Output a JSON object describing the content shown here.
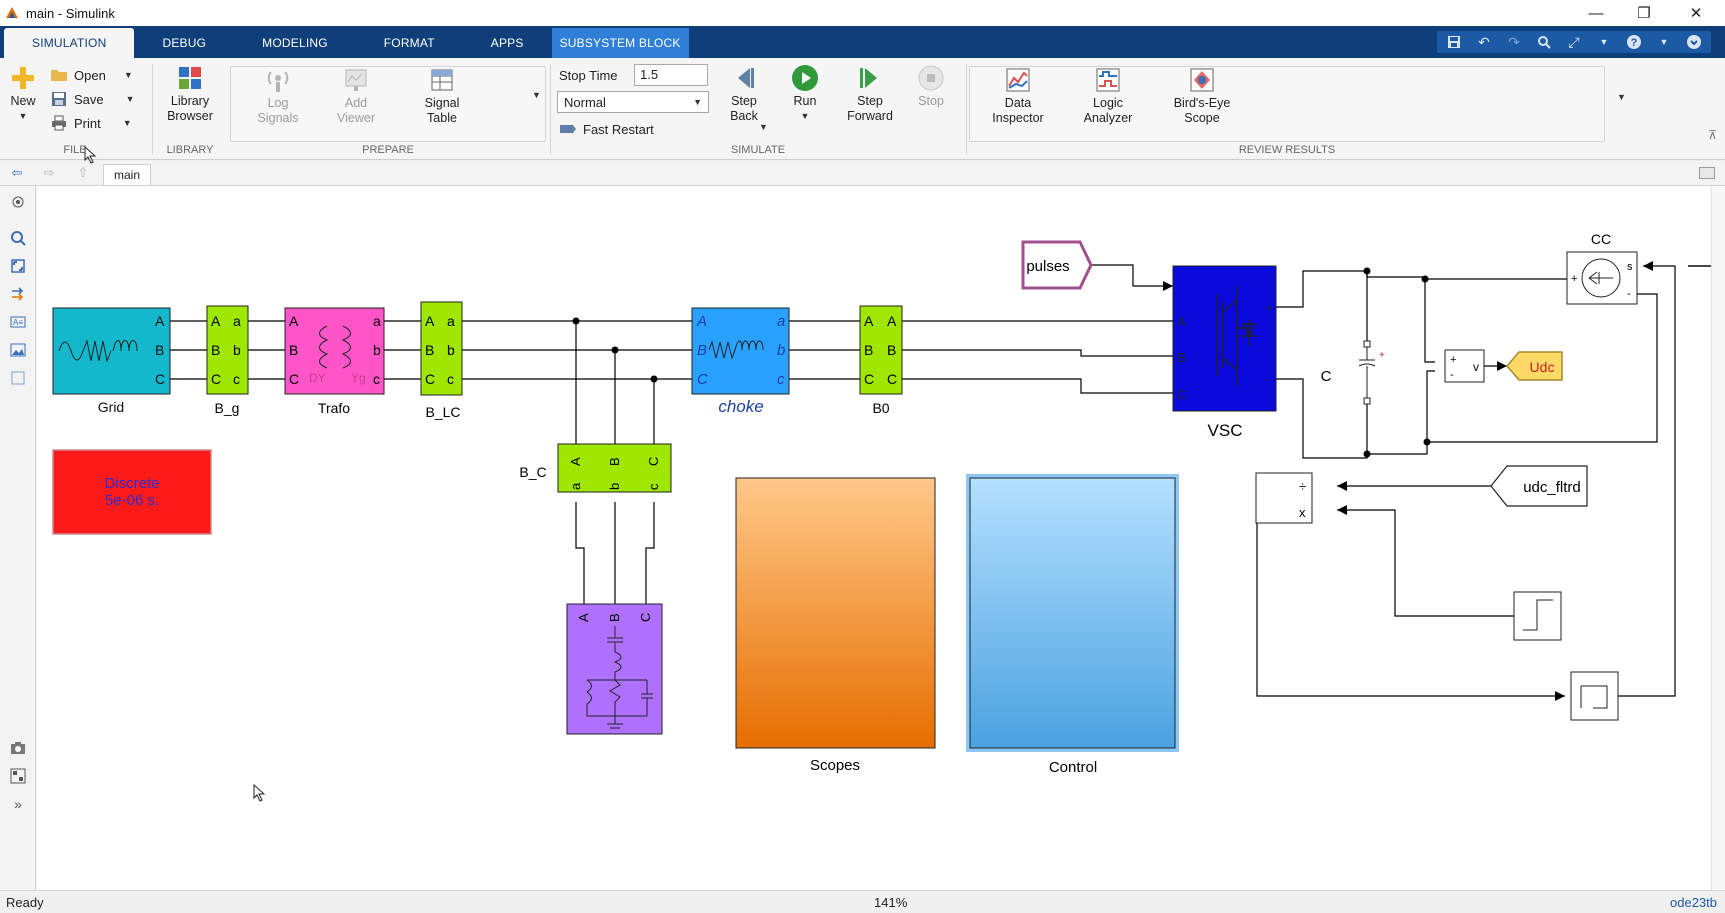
{
  "window": {
    "title": "main - Simulink",
    "controls": {
      "minimize": "—",
      "restore": "❐",
      "close": "✕"
    }
  },
  "tabs": [
    {
      "label": "SIMULATION",
      "active": true
    },
    {
      "label": "DEBUG"
    },
    {
      "label": "MODELING"
    },
    {
      "label": "FORMAT"
    },
    {
      "label": "APPS"
    },
    {
      "label": "SUBSYSTEM BLOCK",
      "contextual": true
    }
  ],
  "ribbon": {
    "file": {
      "group_label": "FILE",
      "new_label": "New",
      "open_label": "Open",
      "save_label": "Save",
      "print_label": "Print"
    },
    "library": {
      "group_label": "LIBRARY",
      "browser_label_1": "Library",
      "browser_label_2": "Browser"
    },
    "prepare": {
      "group_label": "PREPARE",
      "log_signals_1": "Log",
      "log_signals_2": "Signals",
      "add_viewer_1": "Add",
      "add_viewer_2": "Viewer",
      "signal_table_1": "Signal",
      "signal_table_2": "Table"
    },
    "simulate": {
      "group_label": "SIMULATE",
      "stop_time_label": "Stop Time",
      "stop_time_value": "1.5",
      "mode_value": "Normal",
      "fast_restart_label": "Fast Restart",
      "step_back_1": "Step",
      "step_back_2": "Back",
      "run_label": "Run",
      "step_forward_1": "Step",
      "step_forward_2": "Forward",
      "stop_label": "Stop"
    },
    "review": {
      "group_label": "REVIEW RESULTS",
      "data_inspector_1": "Data",
      "data_inspector_2": "Inspector",
      "logic_analyzer_1": "Logic",
      "logic_analyzer_2": "Analyzer",
      "birds_eye_1": "Bird's-Eye",
      "birds_eye_2": "Scope"
    }
  },
  "breadcrumb": {
    "model": "main"
  },
  "diagram": {
    "blocks": {
      "grid": "Grid",
      "b_g": "B_g",
      "trafo": "Trafo",
      "trafo_dy": "DY",
      "trafo_yg": "Yg",
      "b_lc": "B_LC",
      "b_c": "B_C",
      "choke": "choke",
      "b0": "B0",
      "vsc": "VSC",
      "cap": "C",
      "cc": "CC",
      "pulses": "pulses",
      "udc": "Udc",
      "udc_fltrd": "udc_fltrd",
      "powergui_1": "Discrete",
      "powergui_2": "5e-06 s.",
      "scopes": "Scopes",
      "control": "Control",
      "v_label": "v",
      "s_label": "s",
      "plus": "+",
      "minus": "-",
      "div": "÷",
      "mul": "x"
    },
    "ports": {
      "A": "A",
      "B": "B",
      "C": "C",
      "a": "a",
      "b": "b",
      "c": "c"
    },
    "colors": {
      "grid": "#13b8cc",
      "lime": "#9fe600",
      "trafo": "#ff55c8",
      "choke": "#29a2ff",
      "vsc": "#0a0adc",
      "powergui": "#ff1a1a",
      "scopes_top": "#ffc98a",
      "scopes_bottom": "#e66e00",
      "control_top": "#b5e0ff",
      "control_bottom": "#4aa2e0",
      "filter": "#b070ff",
      "udc": "#ffd966"
    }
  },
  "status": {
    "state": "Ready",
    "zoom": "141%",
    "solver": "ode23tb"
  }
}
